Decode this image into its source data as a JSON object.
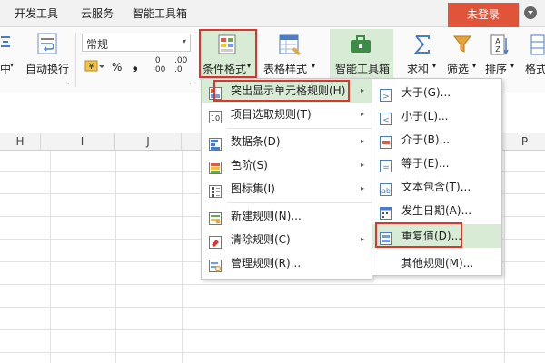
{
  "tabs": {
    "developer": "开发工具",
    "cloud": "云服务",
    "smart": "智能工具箱"
  },
  "top_right": {
    "login": "未登录",
    "help_icon": "▾"
  },
  "ribbon": {
    "zhong": "中",
    "wrap": "自动换行",
    "number_format": "常规",
    "percent": "%",
    "comma": "❟",
    "dec_up": ".00",
    "dec_down": ".0",
    "dec_up2": "+.0",
    "dec_down2": "+.00",
    "cond_format": "条件格式",
    "table_style": "表格样式",
    "smart_toolbox": "智能工具箱",
    "sum": "求和",
    "filter": "筛选",
    "sort": "排序",
    "format": "格式"
  },
  "columns": [
    "H",
    "I",
    "J",
    "P"
  ],
  "menu": {
    "items": [
      {
        "label": "突出显示单元格规则(H)",
        "has_sub": true
      },
      {
        "label": "项目选取规则(T)",
        "has_sub": true
      },
      {
        "label": "数据条(D)",
        "has_sub": true
      },
      {
        "label": "色阶(S)",
        "has_sub": true
      },
      {
        "label": "图标集(I)",
        "has_sub": true
      },
      {
        "label": "新建规则(N)...",
        "has_sub": false
      },
      {
        "label": "清除规则(C)",
        "has_sub": true
      },
      {
        "label": "管理规则(R)...",
        "has_sub": false
      }
    ]
  },
  "submenu": {
    "items": [
      {
        "label": "大于(G)..."
      },
      {
        "label": "小于(L)..."
      },
      {
        "label": "介于(B)..."
      },
      {
        "label": "等于(E)..."
      },
      {
        "label": "文本包含(T)..."
      },
      {
        "label": "发生日期(A)..."
      },
      {
        "label": "重复值(D)..."
      },
      {
        "label": "其他规则(M)..."
      }
    ]
  },
  "colors": {
    "highlight": "#d9372d",
    "login_bg": "#e0553a",
    "hover_green": "#d8ecd5"
  }
}
